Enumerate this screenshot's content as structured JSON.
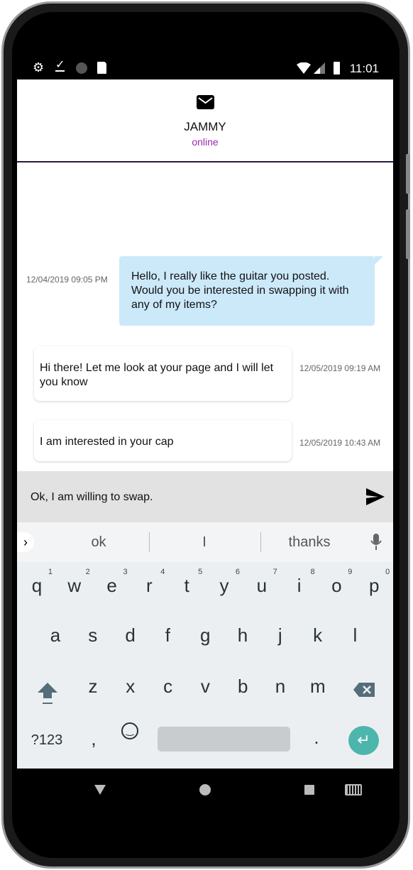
{
  "status_bar": {
    "time": "11:01",
    "left_icons": [
      "gear-icon",
      "download-done-icon",
      "sync-circle-icon",
      "sd-card-icon"
    ],
    "right_icons": [
      "wifi-icon",
      "signal-icon",
      "battery-icon"
    ]
  },
  "header": {
    "icon": "mail-icon",
    "title": "JAMMY",
    "status": "online",
    "status_color": "#9c27b0"
  },
  "messages": [
    {
      "direction": "outgoing",
      "text": "Hello, I really like the guitar you posted. Would you be interested in swapping it with any of my items?",
      "timestamp": "12/04/2019 09:05 PM"
    },
    {
      "direction": "incoming",
      "text": "Hi there! Let me look at your page and I will let you know",
      "timestamp": "12/05/2019 09:19 AM"
    },
    {
      "direction": "incoming",
      "text": "I am interested in your cap",
      "timestamp": "12/05/2019 10:43 AM"
    }
  ],
  "composer": {
    "value": "Ok, I am willing to swap.",
    "send_icon": "send-icon"
  },
  "keyboard": {
    "suggestions": [
      "ok",
      "I",
      "thanks"
    ],
    "row1": [
      "q",
      "w",
      "e",
      "r",
      "t",
      "y",
      "u",
      "i",
      "o",
      "p"
    ],
    "row1_hints": [
      "1",
      "2",
      "3",
      "4",
      "5",
      "6",
      "7",
      "8",
      "9",
      "0"
    ],
    "row2": [
      "a",
      "s",
      "d",
      "f",
      "g",
      "h",
      "j",
      "k",
      "l"
    ],
    "row3": [
      "z",
      "x",
      "c",
      "v",
      "b",
      "n",
      "m"
    ],
    "symbols": "?123",
    "comma": ",",
    "period": "."
  },
  "colors": {
    "outgoing_bubble": "#cce9fa",
    "enter_key": "#4db6ac"
  }
}
